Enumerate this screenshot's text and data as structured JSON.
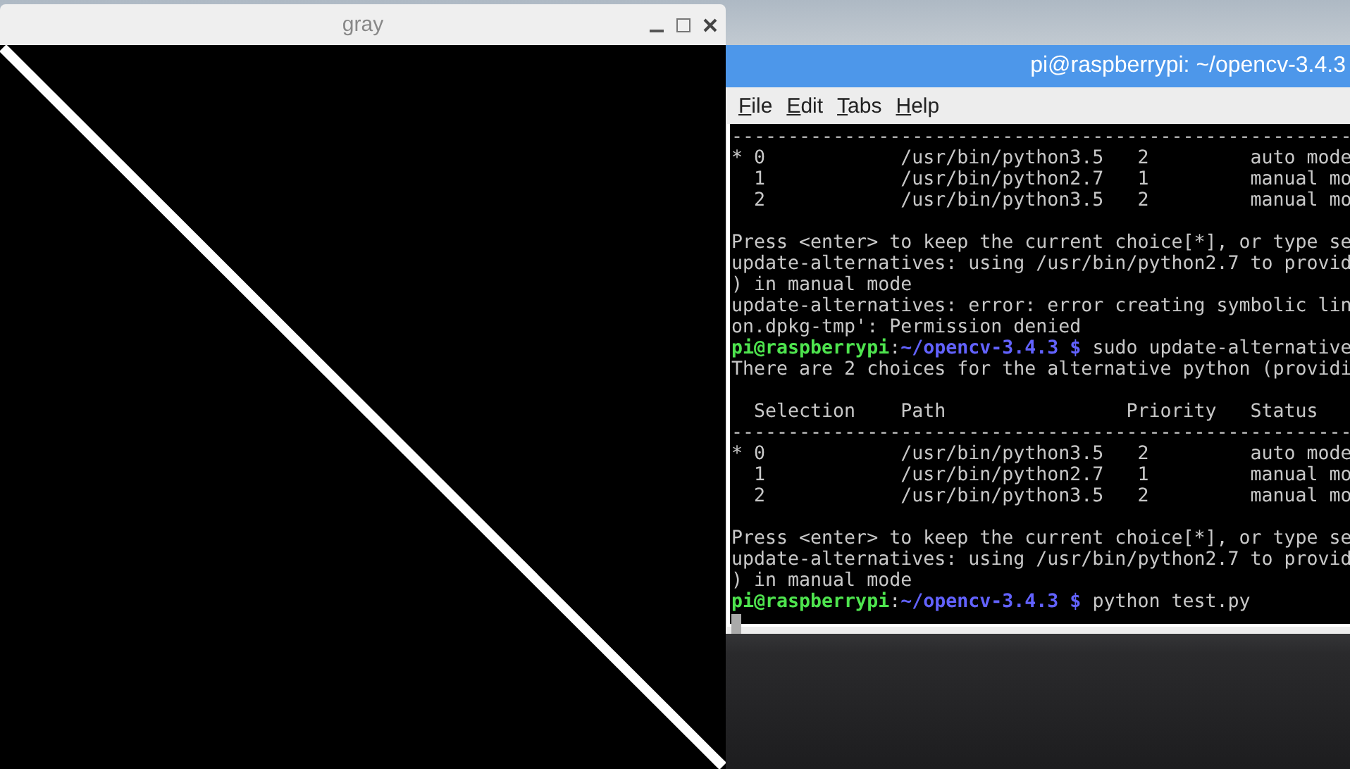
{
  "image_window": {
    "title": "gray"
  },
  "terminal": {
    "title": "pi@raspberrypi: ~/opencv-3.4.3",
    "menu": [
      "File",
      "Edit",
      "Tabs",
      "Help"
    ],
    "lines": [
      {
        "kind": "text",
        "segments": [
          {
            "kind": "plain",
            "text": "-------------------------------------------------------"
          }
        ]
      },
      {
        "kind": "text",
        "segments": [
          {
            "kind": "plain",
            "text": "* 0            /usr/bin/python3.5   2         auto mode"
          }
        ]
      },
      {
        "kind": "text",
        "segments": [
          {
            "kind": "plain",
            "text": "  1            /usr/bin/python2.7   1         manual mo"
          }
        ]
      },
      {
        "kind": "text",
        "segments": [
          {
            "kind": "plain",
            "text": "  2            /usr/bin/python3.5   2         manual mo"
          }
        ]
      },
      {
        "kind": "blank"
      },
      {
        "kind": "text",
        "segments": [
          {
            "kind": "plain",
            "text": "Press <enter> to keep the current choice[*], or type se"
          }
        ]
      },
      {
        "kind": "text",
        "segments": [
          {
            "kind": "plain",
            "text": "update-alternatives: using /usr/bin/python2.7 to provid"
          }
        ]
      },
      {
        "kind": "text",
        "segments": [
          {
            "kind": "plain",
            "text": ") in manual mode"
          }
        ]
      },
      {
        "kind": "text",
        "segments": [
          {
            "kind": "plain",
            "text": "update-alternatives: error: error creating symbolic lin"
          }
        ]
      },
      {
        "kind": "text",
        "segments": [
          {
            "kind": "plain",
            "text": "on.dpkg-tmp': Permission denied"
          }
        ]
      },
      {
        "kind": "text",
        "segments": [
          {
            "kind": "user",
            "text": "pi@raspberrypi"
          },
          {
            "kind": "plain",
            "text": ":"
          },
          {
            "kind": "path",
            "text": "~/opencv-3.4.3 $"
          },
          {
            "kind": "plain",
            "text": " sudo update-alternative"
          }
        ]
      },
      {
        "kind": "text",
        "segments": [
          {
            "kind": "plain",
            "text": "There are 2 choices for the alternative python (providi"
          }
        ]
      },
      {
        "kind": "blank"
      },
      {
        "kind": "text",
        "segments": [
          {
            "kind": "plain",
            "text": "  Selection    Path                Priority   Status"
          }
        ]
      },
      {
        "kind": "text",
        "segments": [
          {
            "kind": "plain",
            "text": "-------------------------------------------------------"
          }
        ]
      },
      {
        "kind": "text",
        "segments": [
          {
            "kind": "plain",
            "text": "* 0            /usr/bin/python3.5   2         auto mode"
          }
        ]
      },
      {
        "kind": "text",
        "segments": [
          {
            "kind": "plain",
            "text": "  1            /usr/bin/python2.7   1         manual mo"
          }
        ]
      },
      {
        "kind": "text",
        "segments": [
          {
            "kind": "plain",
            "text": "  2            /usr/bin/python3.5   2         manual mo"
          }
        ]
      },
      {
        "kind": "blank"
      },
      {
        "kind": "text",
        "segments": [
          {
            "kind": "plain",
            "text": "Press <enter> to keep the current choice[*], or type se"
          }
        ]
      },
      {
        "kind": "text",
        "segments": [
          {
            "kind": "plain",
            "text": "update-alternatives: using /usr/bin/python2.7 to provid"
          }
        ]
      },
      {
        "kind": "text",
        "segments": [
          {
            "kind": "plain",
            "text": ") in manual mode"
          }
        ]
      },
      {
        "kind": "text",
        "segments": [
          {
            "kind": "user",
            "text": "pi@raspberrypi"
          },
          {
            "kind": "plain",
            "text": ":"
          },
          {
            "kind": "path",
            "text": "~/opencv-3.4.3 $"
          },
          {
            "kind": "plain",
            "text": " python test.py"
          }
        ]
      },
      {
        "kind": "cursor"
      }
    ]
  }
}
